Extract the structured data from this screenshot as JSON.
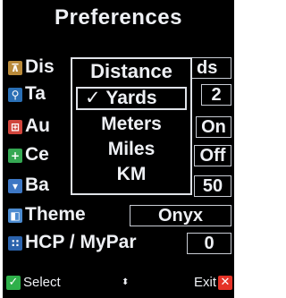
{
  "screen": {
    "title": "Preferences"
  },
  "rows": [
    {
      "label": "Distance",
      "visible_label": "Dis",
      "value_partial": "ds",
      "icon": "distance-icon",
      "icon_color": "#b98a3a",
      "icon_glyph": "⊼"
    },
    {
      "label": "Ta",
      "visible_label": "Ta",
      "value": "2",
      "icon": "search-icon",
      "icon_color": "#2a6fb5",
      "icon_glyph": "⚲"
    },
    {
      "label": "Au",
      "visible_label": "Au",
      "value": "On",
      "icon": "auto-icon",
      "icon_color": "#d0453c",
      "icon_glyph": "⊞"
    },
    {
      "label": "Ce",
      "visible_label": "Ce",
      "value": "Off",
      "icon": "plus-icon",
      "icon_color": "#35a853",
      "icon_glyph": "+"
    },
    {
      "label": "Ba",
      "visible_label": "Ba",
      "value": "50",
      "icon": "battery-icon",
      "icon_color": "#3d77c4",
      "icon_glyph": "▾"
    },
    {
      "label": "Theme",
      "visible_label": "Theme",
      "value": "Onyx",
      "icon": "theme-icon",
      "icon_color": "#4c8bd0",
      "icon_glyph": "◧"
    },
    {
      "label": "HCP / MyPar",
      "visible_label": "HCP / MyPar",
      "value": "0",
      "icon": "hcp-icon",
      "icon_color": "#2b63ad",
      "icon_glyph": "∷"
    }
  ],
  "dropdown": {
    "title": "Distance",
    "options": [
      "Yards",
      "Meters",
      "Miles",
      "KM"
    ],
    "selected": "Yards",
    "check_glyph": "✓"
  },
  "softkeys": {
    "left_label": "Select",
    "right_label": "Exit",
    "nav_glyph": "⬍"
  },
  "colors": {
    "background": "#000000",
    "text": "#eef0f4",
    "select": "#2eb04a",
    "exit": "#e53226"
  }
}
